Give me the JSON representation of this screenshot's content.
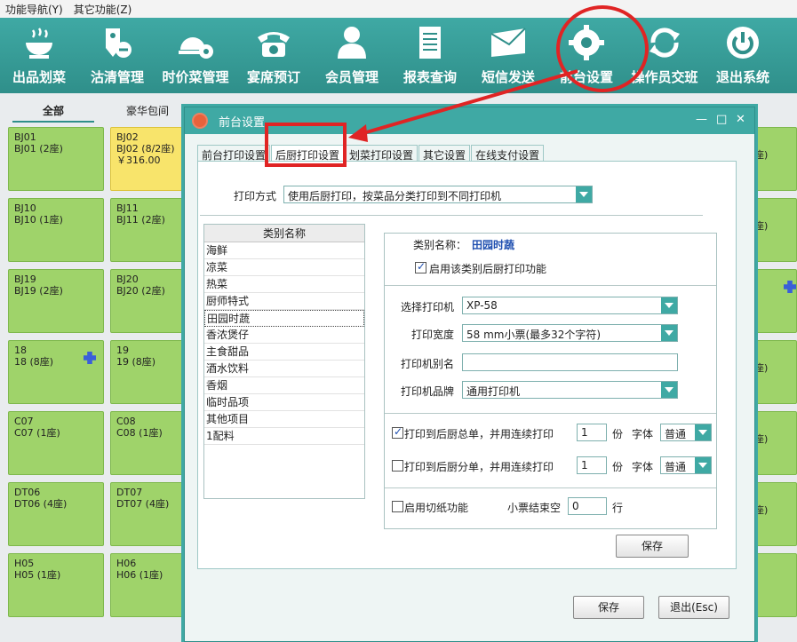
{
  "menubar": {
    "items": [
      "功能导航(Y)",
      "其它功能(Z)"
    ]
  },
  "toolbar": {
    "items": [
      {
        "label": "出品划菜",
        "icon": "bowl-icon"
      },
      {
        "label": "沽清管理",
        "icon": "price-tag-icon"
      },
      {
        "label": "时价菜管理",
        "icon": "cloche-gear-icon"
      },
      {
        "label": "宴席预订",
        "icon": "telephone-icon"
      },
      {
        "label": "会员管理",
        "icon": "person-icon"
      },
      {
        "label": "报表查询",
        "icon": "document-icon"
      },
      {
        "label": "短信发送",
        "icon": "envelope-icon"
      },
      {
        "label": "前台设置",
        "icon": "gear-icon"
      },
      {
        "label": "操作员交班",
        "icon": "refresh-icon"
      },
      {
        "label": "退出系统",
        "icon": "power-icon"
      }
    ]
  },
  "background": {
    "tabs": [
      "全部",
      "豪华包间"
    ],
    "tables": [
      {
        "code": "BJ01",
        "name": "BJ01 (2座)",
        "amount": ""
      },
      {
        "code": "BJ02",
        "name": "BJ02 (8/2座)",
        "amount": "￥316.00"
      },
      {
        "code": "BJ10",
        "name": "BJ10 (1座)",
        "amount": ""
      },
      {
        "code": "BJ11",
        "name": "BJ11 (2座)",
        "amount": ""
      },
      {
        "code": "BJ19",
        "name": "BJ19 (2座)",
        "amount": ""
      },
      {
        "code": "BJ20",
        "name": "BJ20 (2座)",
        "amount": ""
      },
      {
        "code": "18",
        "name": "18 (8座)",
        "amount": ""
      },
      {
        "code": "19",
        "name": "19 (8座)",
        "amount": ""
      },
      {
        "code": "C07",
        "name": "C07 (1座)",
        "amount": ""
      },
      {
        "code": "C08",
        "name": "C08 (1座)",
        "amount": ""
      },
      {
        "code": "DT06",
        "name": "DT06 (4座)",
        "amount": ""
      },
      {
        "code": "DT07",
        "name": "DT07 (4座)",
        "amount": ""
      },
      {
        "code": "H05",
        "name": "H05 (1座)",
        "amount": ""
      },
      {
        "code": "H06",
        "name": "H06 (1座)",
        "amount": ""
      }
    ],
    "right_partial": [
      "座)",
      "座)",
      "座)",
      "座)",
      "座)"
    ]
  },
  "dialog": {
    "title": "前台设置",
    "controls": {
      "minimize": "—",
      "maximize": "□",
      "close": "✕"
    },
    "tabs": [
      "前台打印设置",
      "后厨打印设置",
      "划菜打印设置",
      "其它设置",
      "在线支付设置"
    ],
    "active_tab": "后厨打印设置",
    "print_mode_label": "打印方式",
    "print_mode_value": "使用后厨打印，按菜品分类打印到不同打印机",
    "category_header": "类别名称",
    "categories": [
      "海鲜",
      "凉菜",
      "热菜",
      "厨师特式",
      "田园时蔬",
      "香浓煲仔",
      "主食甜品",
      "酒水饮料",
      "香烟",
      "临时品项",
      "其他项目",
      "1配料"
    ],
    "selected_category": "田园时蔬",
    "detail": {
      "category_name_label": "类别名称：",
      "category_name_value": "田园时蔬",
      "enable_label": "启用该类别后厨打印功能",
      "enable_checked": true,
      "printer_label": "选择打印机",
      "printer_value": "XP-58",
      "width_label": "打印宽度",
      "width_value": "58 mm小票(最多32个字符)",
      "alias_label": "打印机别名",
      "alias_value": "",
      "brand_label": "打印机品牌",
      "brand_value": "通用打印机",
      "total_label": "打印到后厨总单，并用连续打印",
      "total_checked": true,
      "total_copies": "1",
      "split_label": "打印到后厨分单，并用连续打印",
      "split_checked": false,
      "split_copies": "1",
      "copies_unit": "份",
      "font_label": "字体",
      "font_value": "普通",
      "cut_label": "启用切纸功能",
      "cut_checked": false,
      "blank_label": "小票结束空",
      "blank_value": "0",
      "blank_unit": "行",
      "save_label": "保存"
    },
    "footer": {
      "save_label": "保存",
      "exit_label": "退出(Esc)"
    }
  },
  "colors": {
    "toolbar": "#3fa9a4",
    "table_free": "#9fd36a",
    "table_busy": "#f8e46b",
    "annotation": "#e02424",
    "accent_text": "#1f4fb0"
  }
}
